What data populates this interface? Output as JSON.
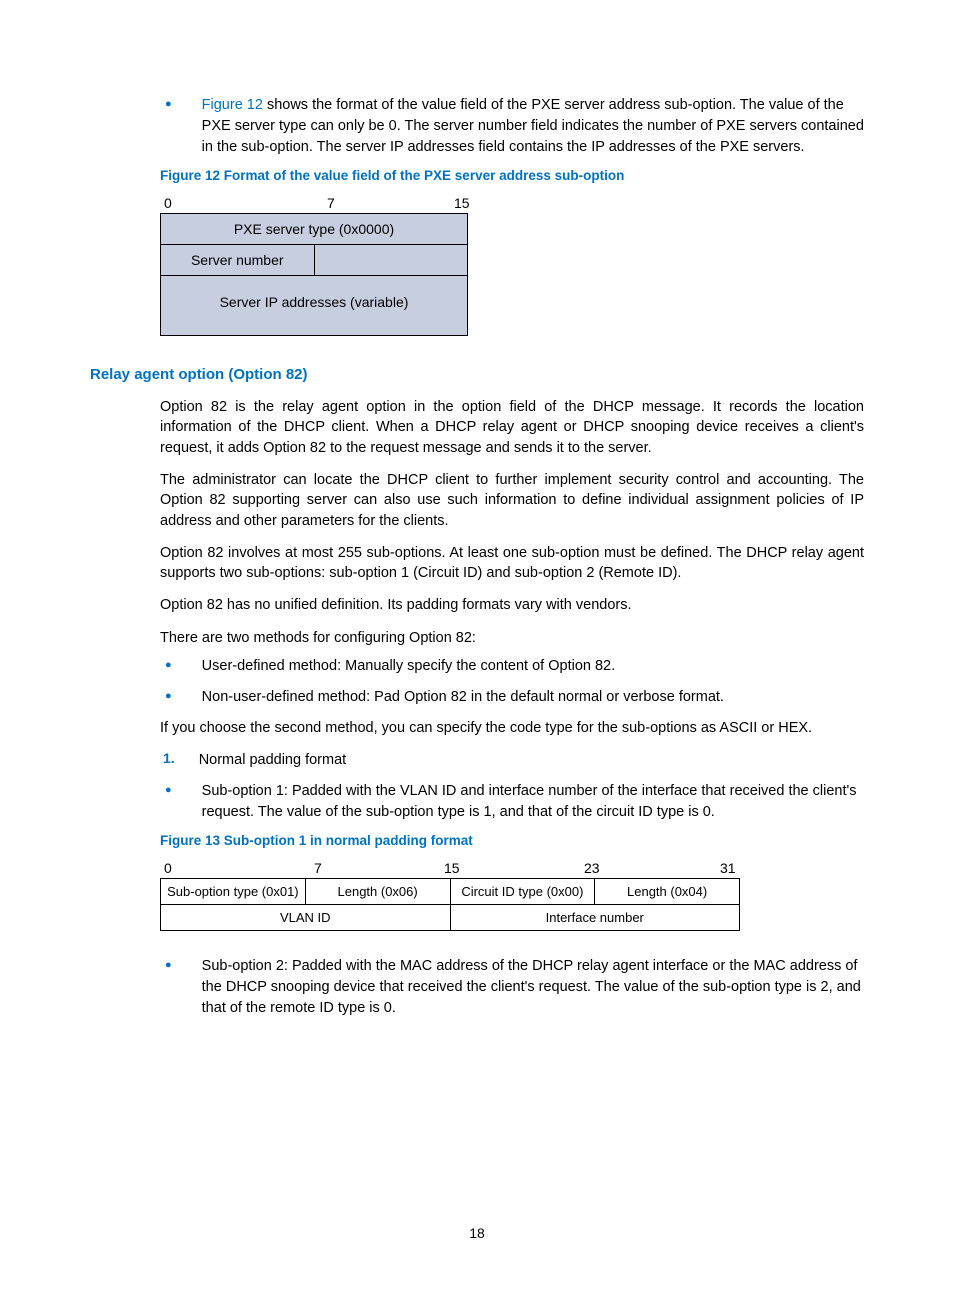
{
  "intro_bullet": {
    "link": "Figure 12",
    "text": " shows the format of the value field of the PXE server address sub-option. The value of the PXE server type can only be 0. The server number field indicates the number of PXE servers contained in the sub-option. The server IP addresses field contains the IP addresses of the PXE servers."
  },
  "figure12": {
    "caption": "Figure 12 Format of the value field of the PXE server address sub-option",
    "ticks": {
      "t0": "0",
      "t7": "7",
      "t15": "15"
    },
    "row1": "PXE server type (0x0000)",
    "row2_c1": "Server number",
    "row3": "Server IP addresses (variable)"
  },
  "heading": "Relay agent option (Option 82)",
  "paras": [
    "Option 82 is the relay agent option in the option field of the DHCP message. It records the location information of the DHCP client. When a DHCP relay agent or DHCP snooping device receives a client's request, it adds Option 82 to the request message and sends it to the server.",
    "The administrator can locate the DHCP client to further implement security control and accounting. The Option 82 supporting server can also use such information to define individual assignment policies of IP address and other parameters for the clients.",
    "Option 82 involves at most 255 sub-options. At least one sub-option must be defined. The DHCP relay agent supports two sub-options: sub-option 1 (Circuit ID) and sub-option 2 (Remote ID).",
    "Option 82 has no unified definition. Its padding formats vary with vendors.",
    "There are two methods for configuring Option 82:"
  ],
  "methods": [
    "User-defined method: Manually specify the content of Option 82.",
    "Non-user-defined method: Pad Option 82 in the default normal or verbose format."
  ],
  "para_after": "If you choose the second method, you can specify the code type for the sub-options as ASCII or HEX.",
  "numbered": {
    "n": "1.",
    "text": "Normal padding format"
  },
  "subopt1": "Sub-option 1: Padded with the VLAN ID and interface number of the interface that received the client's request. The value of the sub-option type is 1, and that of the circuit ID type is 0.",
  "figure13": {
    "caption": "Figure 13 Sub-option 1 in normal padding format",
    "ticks": {
      "f0": "0",
      "f7": "7",
      "f15": "15",
      "f23": "23",
      "f31": "31"
    },
    "row1": [
      "Sub-option type (0x01)",
      "Length (0x06)",
      "Circuit ID type (0x00)",
      "Length (0x04)"
    ],
    "row2": [
      "VLAN ID",
      "Interface number"
    ]
  },
  "subopt2": "Sub-option 2: Padded with the MAC address of the DHCP relay agent interface or the MAC address of the DHCP snooping device that received the client's request. The value of the sub-option type is 2, and that of the remote ID type is 0.",
  "page_number": "18"
}
